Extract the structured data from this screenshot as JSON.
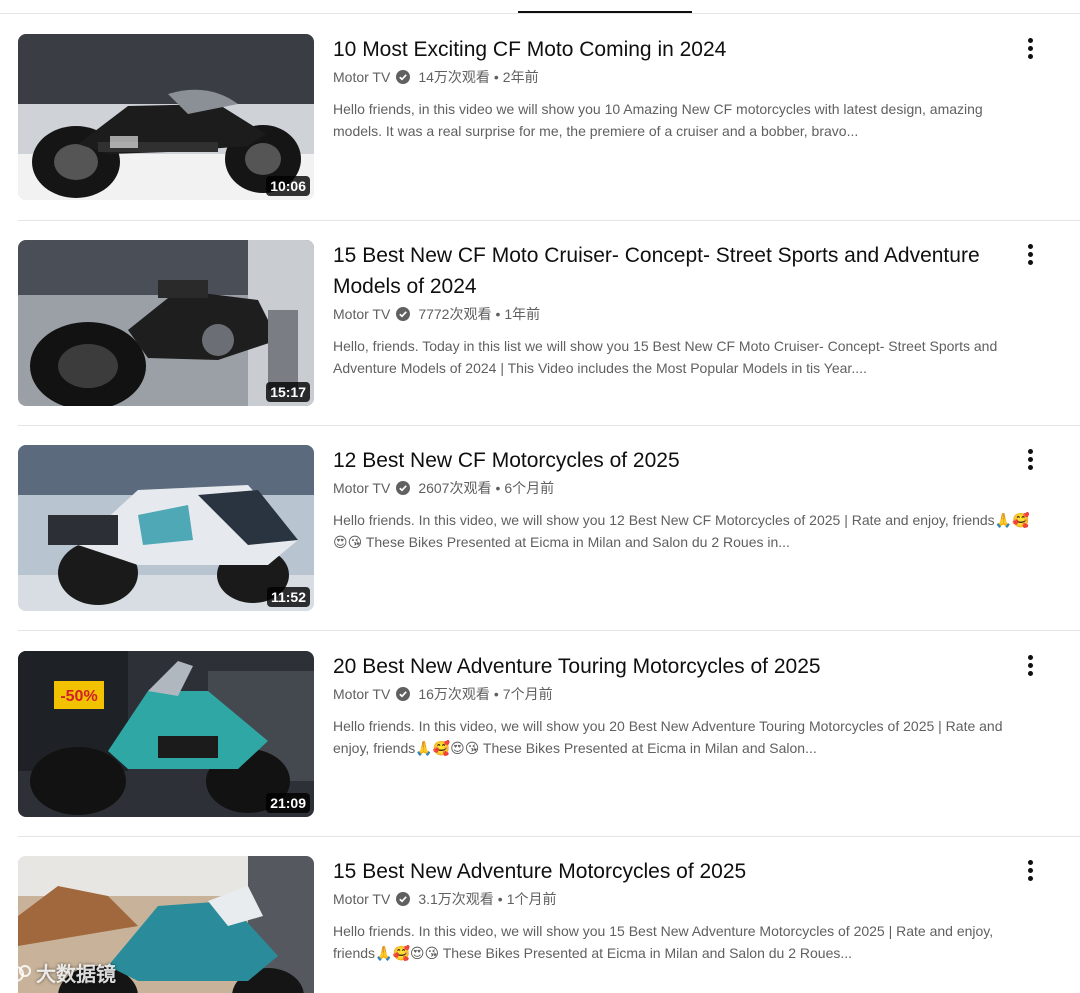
{
  "videos": [
    {
      "title": "10 Most Exciting CF Moto Coming in 2024",
      "channel": "Motor TV",
      "views": "14万次观看",
      "age": "2年前",
      "duration": "10:06",
      "description_lines": [
        "Hello friends, in this video we will show you 10 Amazing New CF motorcycles with latest design, amazing",
        "models. It was a real surprise for me, the premiere of a cruiser and a bobber, bravo..."
      ]
    },
    {
      "title": "15 Best New CF Moto Cruiser- Concept- Street Sports and Adventure Models of 2024",
      "channel": "Motor TV",
      "views": "7772次观看",
      "age": "1年前",
      "duration": "15:17",
      "description_lines": [
        "Hello, friends. Today in this list we will show you 15 Best New CF Moto Cruiser- Concept- Street Sports and",
        "Adventure Models of 2024 | This Video includes the Most Popular Models in tis Year...."
      ]
    },
    {
      "title": "12 Best New CF Motorcycles of 2025",
      "channel": "Motor TV",
      "views": "2607次观看",
      "age": "6个月前",
      "duration": "11:52",
      "description_lines": [
        "Hello friends. In this video, we will show you 12 Best New CF Motorcycles of 2025 | Rate and enjoy, friends🙏🥰",
        "😍😘 These Bikes Presented at Eicma in Milan and Salon du 2 Roues in..."
      ]
    },
    {
      "title": "20 Best New Adventure Touring Motorcycles of 2025",
      "channel": "Motor TV",
      "views": "16万次观看",
      "age": "7个月前",
      "duration": "21:09",
      "description_lines": [
        "Hello friends. In this video, we will show you 20 Best New Adventure Touring Motorcycles of 2025 | Rate and",
        "enjoy, friends🙏🥰😍😘 These Bikes Presented at Eicma in Milan and Salon..."
      ]
    },
    {
      "title": "15 Best New Adventure Motorcycles of 2025",
      "channel": "Motor TV",
      "views": "3.1万次观看",
      "age": "1个月前",
      "duration": "",
      "description_lines": [
        "Hello friends. In this video, we will show you 15 Best New Adventure Motorcycles of 2025 | Rate and enjoy,",
        "friends🙏🥰😍😘 These Bikes Presented at Eicma in Milan and Salon du 2 Roues..."
      ]
    }
  ],
  "thumbnail_sign_text": "-50%",
  "watermark": "大数据镜",
  "meta_separator": "•",
  "colors": {
    "title": "#0f0f0f",
    "meta": "#606060",
    "divider": "#e5e5e5"
  }
}
